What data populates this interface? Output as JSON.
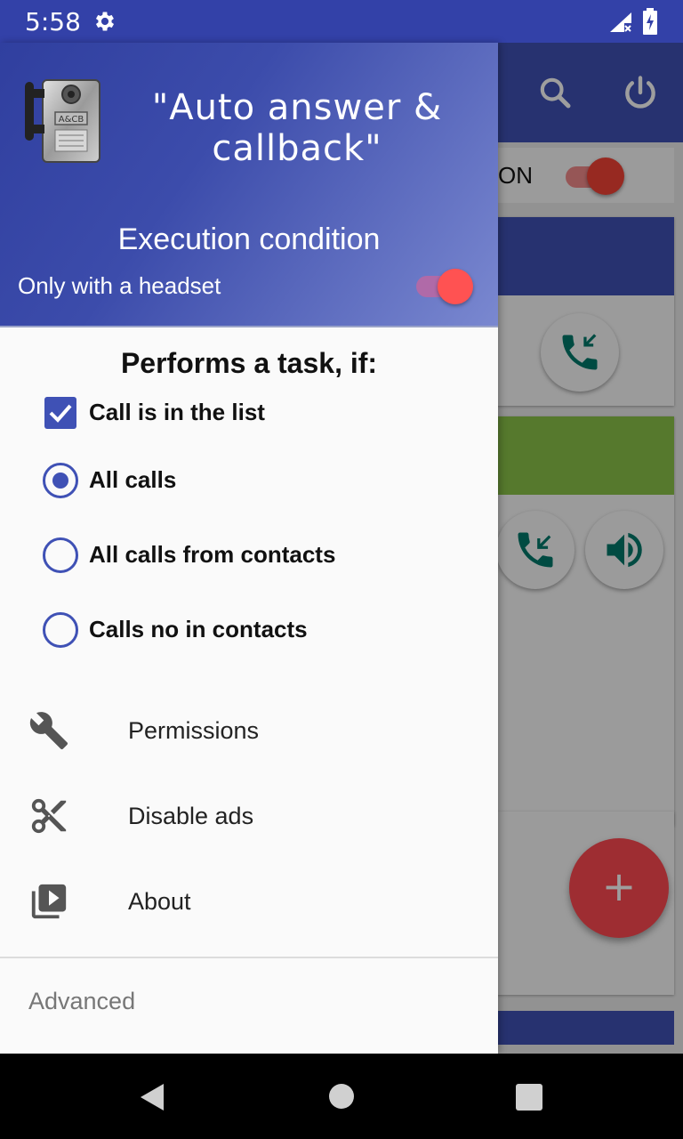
{
  "status_bar": {
    "time": "5:58",
    "icons": [
      "gear-icon",
      "signal-icon",
      "battery-charging-icon"
    ],
    "color": "#3341a8"
  },
  "background": {
    "on_label": "ON",
    "toolbar_icons": [
      "search-icon",
      "power-icon"
    ],
    "fab_label": "+",
    "colors": {
      "toolbar": "#3f51b5",
      "accent": "#f44336",
      "green_band": "#8bc34a",
      "blue_band": "#3f51b5"
    }
  },
  "drawer": {
    "header": {
      "app_title": "\"Auto answer & callback\"",
      "logo_text": "A&CB",
      "execution_title": "Execution condition",
      "headset_label": "Only with a headset",
      "headset_switch_on": true
    },
    "task_heading": "Performs a task, if:",
    "options": {
      "in_list": {
        "label": "Call is in the list",
        "checked": true
      },
      "all_calls": {
        "label": "All calls",
        "selected": true
      },
      "from_contacts": {
        "label": "All calls from contacts",
        "selected": false
      },
      "not_in_contacts": {
        "label": "Calls no in contacts",
        "selected": false
      }
    },
    "menu": [
      {
        "label": "Permissions",
        "icon": "wrench-icon"
      },
      {
        "label": "Disable ads",
        "icon": "scissors-icon"
      },
      {
        "label": "About",
        "icon": "video-library-icon"
      }
    ],
    "advanced_label": "Advanced"
  },
  "nav_bar": {
    "icons": [
      "back-icon",
      "home-icon",
      "recents-icon"
    ]
  }
}
